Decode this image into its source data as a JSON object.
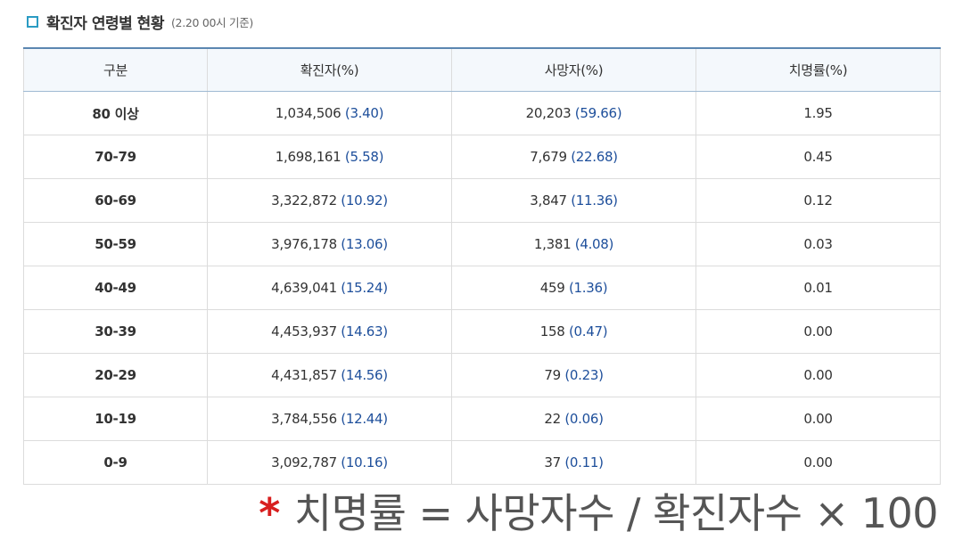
{
  "header": {
    "title": "확진자 연령별 현황",
    "subtitle": "(2.20 00시 기준)"
  },
  "table": {
    "columns": [
      "구분",
      "확진자(%)",
      "사망자(%)",
      "치명률(%)"
    ],
    "rows": [
      {
        "age": "80 이상",
        "cases": "1,034,506",
        "cases_pct": "(3.40)",
        "deaths": "20,203",
        "deaths_pct": "(59.66)",
        "rate": "1.95"
      },
      {
        "age": "70-79",
        "cases": "1,698,161",
        "cases_pct": "(5.58)",
        "deaths": "7,679",
        "deaths_pct": "(22.68)",
        "rate": "0.45"
      },
      {
        "age": "60-69",
        "cases": "3,322,872",
        "cases_pct": "(10.92)",
        "deaths": "3,847",
        "deaths_pct": "(11.36)",
        "rate": "0.12"
      },
      {
        "age": "50-59",
        "cases": "3,976,178",
        "cases_pct": "(13.06)",
        "deaths": "1,381",
        "deaths_pct": "(4.08)",
        "rate": "0.03"
      },
      {
        "age": "40-49",
        "cases": "4,639,041",
        "cases_pct": "(15.24)",
        "deaths": "459",
        "deaths_pct": "(1.36)",
        "rate": "0.01"
      },
      {
        "age": "30-39",
        "cases": "4,453,937",
        "cases_pct": "(14.63)",
        "deaths": "158",
        "deaths_pct": "(0.47)",
        "rate": "0.00"
      },
      {
        "age": "20-29",
        "cases": "4,431,857",
        "cases_pct": "(14.56)",
        "deaths": "79",
        "deaths_pct": "(0.23)",
        "rate": "0.00"
      },
      {
        "age": "10-19",
        "cases": "3,784,556",
        "cases_pct": "(12.44)",
        "deaths": "22",
        "deaths_pct": "(0.06)",
        "rate": "0.00"
      },
      {
        "age": "0-9",
        "cases": "3,092,787",
        "cases_pct": "(10.16)",
        "deaths": "37",
        "deaths_pct": "(0.11)",
        "rate": "0.00"
      }
    ]
  },
  "footnote": {
    "mark": "*",
    "text": "치명률 = 사망자수 / 확진자수 × 100"
  },
  "colors": {
    "accent": "#2a9bc3",
    "value_blue": "#1e4f9b",
    "header_border": "#5b86b1",
    "footnote_mark": "#d81e1e"
  },
  "icons": {
    "heading_bullet": "square-bullet-icon"
  }
}
